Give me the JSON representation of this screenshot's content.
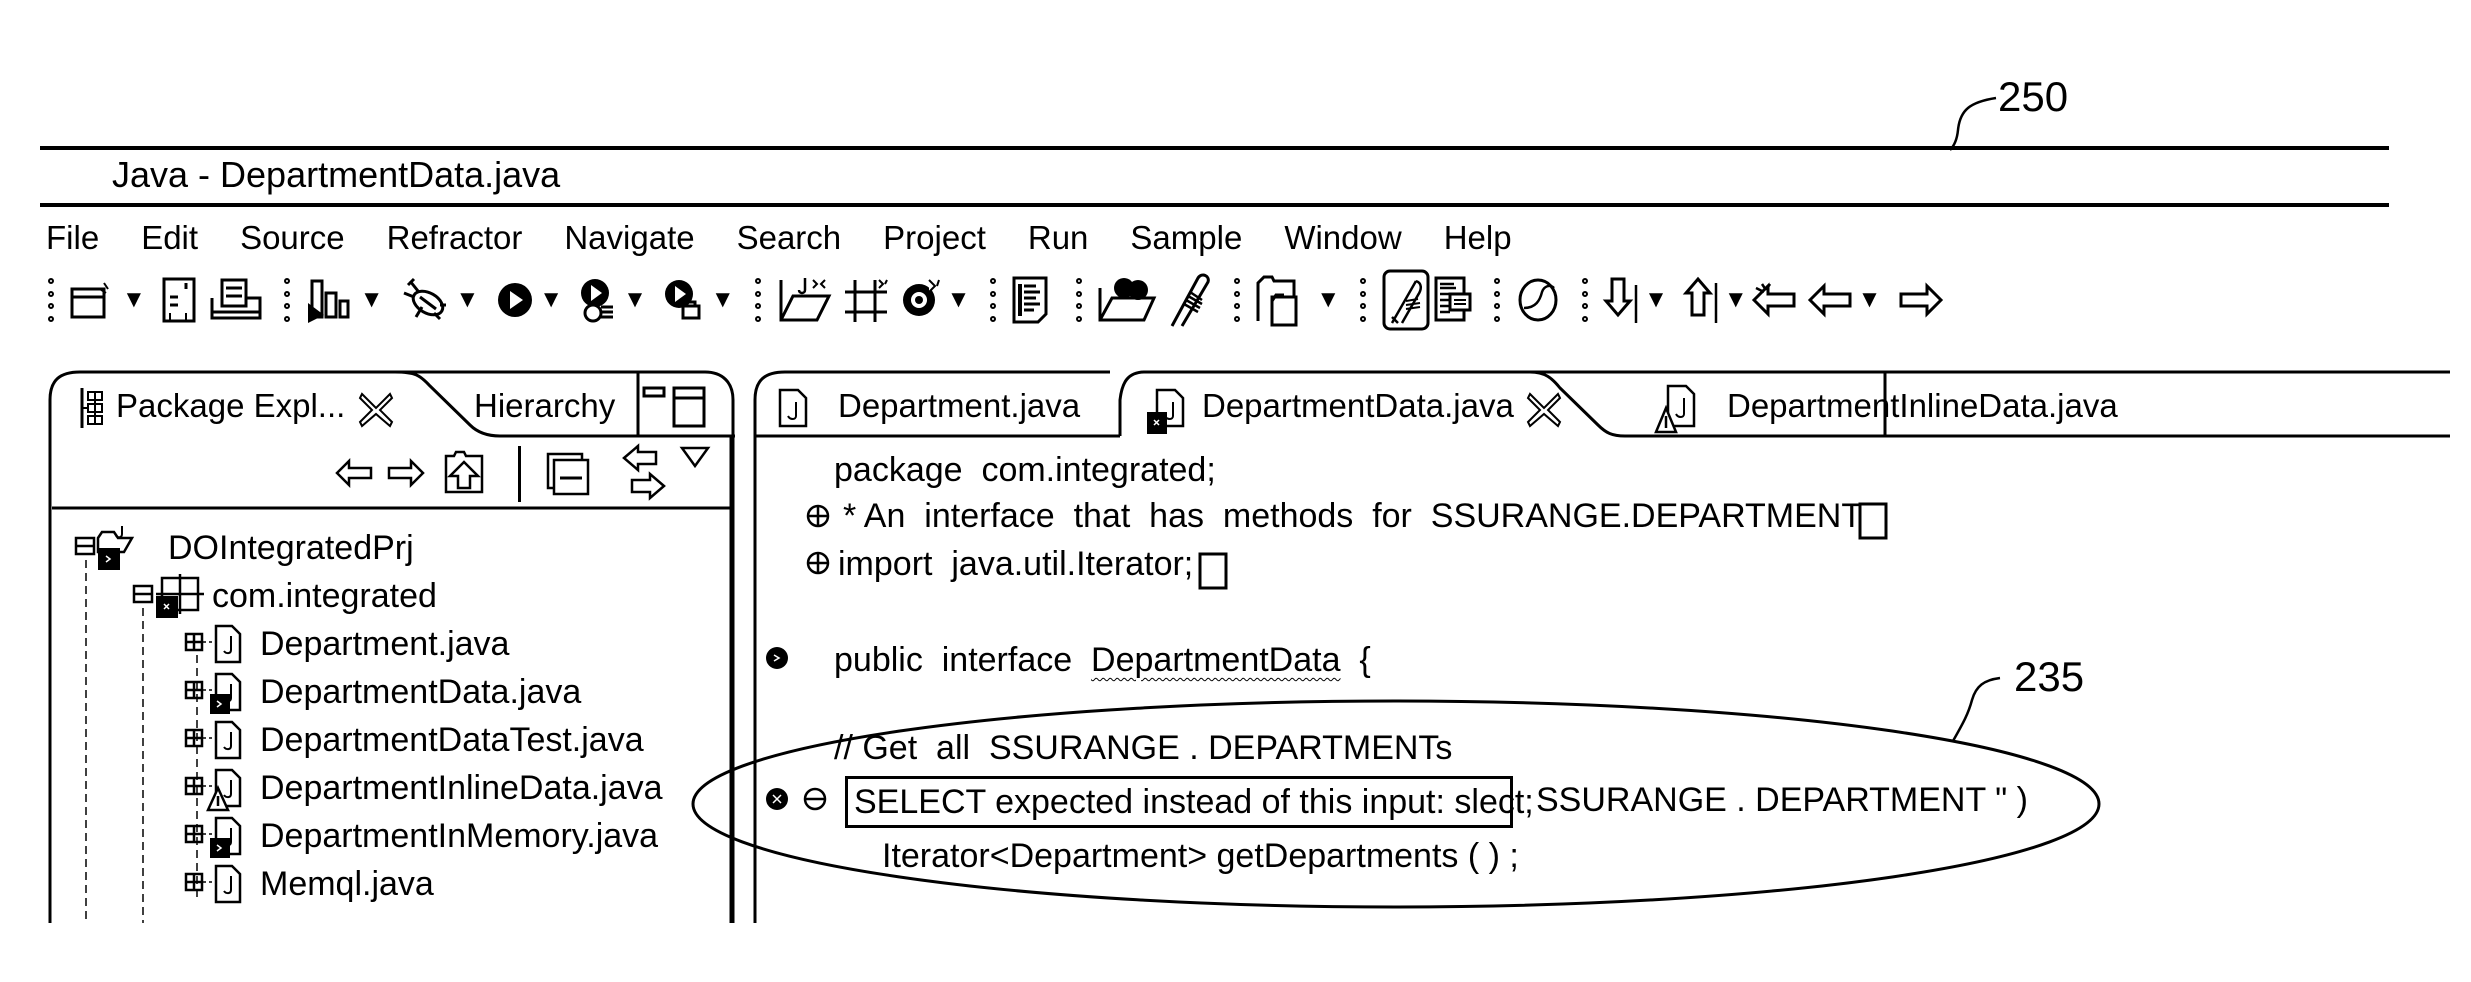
{
  "annotations": {
    "figure_ref": "250",
    "highlight_ref": "235"
  },
  "window": {
    "title": "Java - DepartmentData.java"
  },
  "menu": [
    "File",
    "Edit",
    "Source",
    "Refractor",
    "Navigate",
    "Search",
    "Project",
    "Run",
    "Sample",
    "Window",
    "Help"
  ],
  "toolbar": {
    "icons": [
      "new-wizard-icon",
      "save-icon",
      "print-icon",
      "build-icon",
      "debug-icon",
      "run-icon",
      "run-coverage-icon",
      "external-tools-icon",
      "new-java-project-icon",
      "new-package-icon",
      "new-class-icon",
      "open-type-icon",
      "open-folder-icon",
      "edit-tool-icon",
      "open-perspective-icon",
      "java-perspective-icon",
      "outline-icon",
      "search-icon",
      "next-annotation-icon",
      "previous-annotation-icon",
      "last-edit-location-icon",
      "back-icon",
      "forward-icon"
    ]
  },
  "left_panel": {
    "tabs": [
      {
        "label": "Package Expl...",
        "active": true,
        "icon": "package-explorer-icon"
      },
      {
        "label": "Hierarchy",
        "active": false
      }
    ],
    "tree": [
      {
        "label": "DOIntegratedPrj",
        "level": 0,
        "expanded": true,
        "icon": "java-project-icon",
        "error": true
      },
      {
        "label": "com.integrated",
        "level": 1,
        "expanded": true,
        "icon": "package-icon",
        "error": true
      },
      {
        "label": "Department.java",
        "level": 2,
        "expanded": false,
        "icon": "java-file-icon"
      },
      {
        "label": "DepartmentData.java",
        "level": 2,
        "expanded": false,
        "icon": "java-file-icon",
        "error": true
      },
      {
        "label": "DepartmentDataTest.java",
        "level": 2,
        "expanded": false,
        "icon": "java-file-icon"
      },
      {
        "label": "DepartmentInlineData.java",
        "level": 2,
        "expanded": false,
        "icon": "java-file-icon",
        "warning": true
      },
      {
        "label": "DepartmentInMemory.java",
        "level": 2,
        "expanded": false,
        "icon": "java-file-icon",
        "error": true
      },
      {
        "label": "Memql.java",
        "level": 2,
        "expanded": false,
        "icon": "java-file-icon"
      }
    ]
  },
  "editor": {
    "tabs": [
      {
        "label": "Department.java",
        "active": false
      },
      {
        "label": "DepartmentData.java",
        "active": true,
        "error": true
      },
      {
        "label": "DepartmentInlineData.java",
        "active": false,
        "warning": true
      }
    ],
    "lines": {
      "package": "package  com.integrated;",
      "comment": "* An  interface  that  has  methods  for  SSURANGE.DEPARTMENT",
      "import": "import  java.util.Iterator;",
      "interface_prefix": "public  interface  ",
      "interface_name": "DepartmentData",
      "interface_suffix": "  {",
      "get_comment": "// Get  all  SSURANGE . DEPARTMENTs",
      "error_message": "SELECT expected instead of this input: slect;",
      "error_tail": "SSURANGE . DEPARTMENT \" )",
      "method": "Iterator<Department> getDepartments ( ) ;"
    }
  }
}
